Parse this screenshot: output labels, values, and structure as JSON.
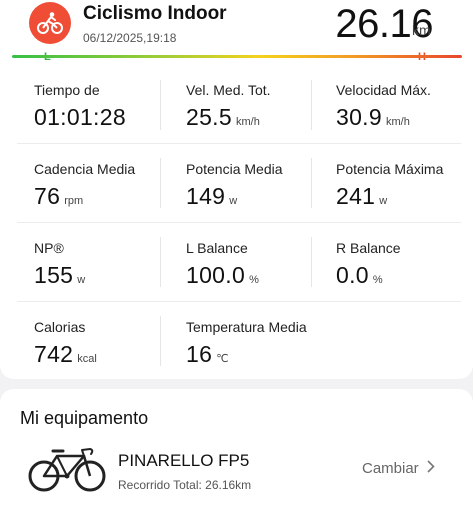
{
  "header": {
    "activity_title": "Ciclismo Indoor",
    "datetime": "06/12/2025,19:18",
    "distance_value": "26.16",
    "distance_unit": "km",
    "intensity_low_label": "L",
    "intensity_high_label": "H",
    "icon": "cycling-icon",
    "accent_color": "#ef4d36"
  },
  "stats": [
    {
      "label": "Tiempo de",
      "value": "01:01:28",
      "unit": ""
    },
    {
      "label": "Vel. Med. Tot.",
      "value": "25.5",
      "unit": "km/h"
    },
    {
      "label": "Velocidad Máx.",
      "value": "30.9",
      "unit": "km/h"
    },
    {
      "label": "Cadencia Media",
      "value": "76",
      "unit": "rpm"
    },
    {
      "label": "Potencia Media",
      "value": "149",
      "unit": "w"
    },
    {
      "label": "Potencia Máxima",
      "value": "241",
      "unit": "w"
    },
    {
      "label": "NP®",
      "value": "155",
      "unit": "w"
    },
    {
      "label": "L Balance",
      "value": "100.0",
      "unit": "%"
    },
    {
      "label": "R Balance",
      "value": "0.0",
      "unit": "%"
    },
    {
      "label": "Calorias",
      "value": "742",
      "unit": "kcal"
    },
    {
      "label": "Temperatura Media",
      "value": "16",
      "unit": "℃"
    }
  ],
  "equipment": {
    "section_title": "Mi equipamento",
    "bike_name": "PINARELLO FP5",
    "bike_distance": "Recorrido Total:  26.16km",
    "change_label": "Cambiar",
    "icon": "road-bike-icon",
    "chevron_icon": "chevron-right-icon"
  }
}
